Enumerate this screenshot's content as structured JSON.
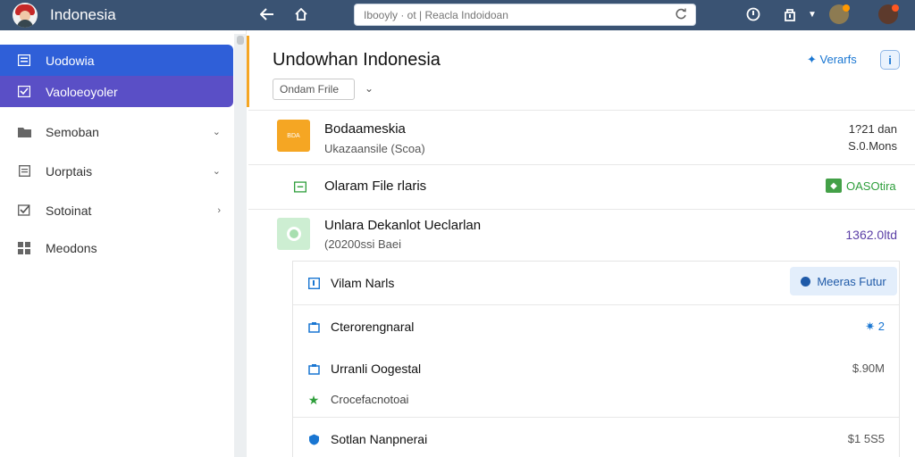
{
  "header": {
    "app_title": "Indonesia",
    "search_placeholder": "Ibooyly · ot | Reacla Indoidoan"
  },
  "sidebar": {
    "items": [
      {
        "label": "Uodowia",
        "icon": "list-icon",
        "active": true
      },
      {
        "label": "Vaoloeoyoler",
        "icon": "checkbox-icon",
        "active": true
      },
      {
        "label": "Semoban",
        "icon": "folder-icon",
        "chevron": true
      },
      {
        "label": "Uorptais",
        "icon": "document-icon",
        "chevron": true
      },
      {
        "label": "Sotoinat",
        "icon": "checked-box-icon",
        "chevron": true
      },
      {
        "label": "Meodons",
        "icon": "grid-icon"
      }
    ]
  },
  "main": {
    "title": "Undowhan Indonesia",
    "new_label": "Verarfs",
    "filter_label": "Ondam Frile",
    "rows": [
      {
        "title": "Bodaameskia",
        "subtitle": "Ukazaansile (Scoa)",
        "value_line1": "1?21 dan",
        "value_line2": "S.0.Mons",
        "thumb_text": "BDA"
      },
      {
        "title": "Olaram File rlaris",
        "status": "OASOtira"
      },
      {
        "title": "Unlara Dekanlot Ueclarlan",
        "subtitle": "(20200ssi Baei",
        "value": "1362.0ltd"
      }
    ],
    "panel": {
      "header_title": "Vilam Narls",
      "match_label": "Meeras Futur",
      "items": [
        {
          "title": "Cterorengnaral",
          "value": "2"
        },
        {
          "title": "Urranli Oogestal",
          "value": "$.90M"
        },
        {
          "title": "Crocefacnotoai",
          "value": ""
        },
        {
          "title": "Sotlan Nanpnerai",
          "value": "$1 5S5"
        }
      ]
    }
  },
  "colors": {
    "topbar": "#3a5373",
    "sidebar_active_1": "#2f5fd8",
    "sidebar_active_2": "#5a4fc6",
    "accent": "#f5a623",
    "status_green": "#2e9e3b",
    "link_blue": "#1976d2",
    "value_purple": "#5b3fa6"
  }
}
